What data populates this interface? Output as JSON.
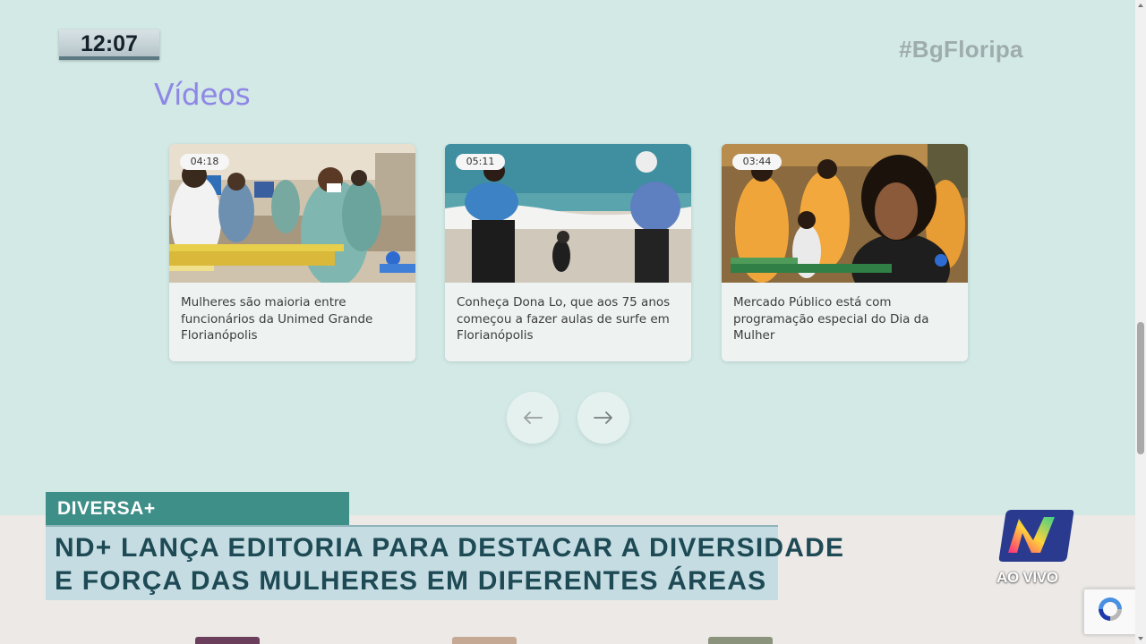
{
  "clock": "12:07",
  "hashtag": "#BgFloripa",
  "section_title": "Vídeos",
  "videos": [
    {
      "duration": "04:18",
      "title": "Mulheres são maioria entre funcionários da Unimed Grande Florianópolis"
    },
    {
      "duration": "05:11",
      "title": "Conheça Dona Lo, que aos 75 anos começou a fazer aulas de surfe em Florianópolis"
    },
    {
      "duration": "03:44",
      "title": "Mercado Público está com programação especial do Dia da Mulher"
    }
  ],
  "nav": {
    "prev_icon": "arrow-left-icon",
    "next_icon": "arrow-right-icon"
  },
  "lower_third": {
    "tag": "DIVERSA+",
    "headline_line1": "ND+ LANÇA EDITORIA PARA DESTACAR A DIVERSIDADE",
    "headline_line2": "E FORÇA DAS MULHERES EM DIFERENTES ÁREAS"
  },
  "channel": {
    "live_label": "AO VIVO"
  },
  "colors": {
    "background": "#d2e9e6",
    "title_purple": "#8f87e6",
    "tag_teal": "#3e8f88",
    "headline_bg": "#c5dde2",
    "headline_text": "#1e4a55"
  }
}
